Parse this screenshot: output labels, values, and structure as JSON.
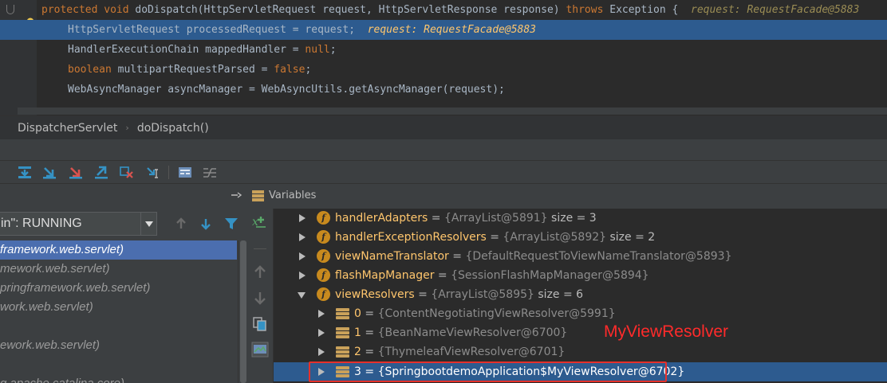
{
  "editor": {
    "lines": [
      {
        "kw1": "protected void ",
        "text": "doDispatch(HttpServletRequest request, HttpServletResponse response) ",
        "kw2": "throws ",
        "rest": "Exception {",
        "inline": "request: RequestFacade@5883"
      },
      {
        "text": "HttpServletRequest processedRequest = request;",
        "inline": "request: RequestFacade@5883"
      },
      {
        "text": "HandlerExecutionChain mappedHandler = ",
        "kw": "null",
        "rest": ";"
      },
      {
        "kw": "boolean ",
        "text": "multipartRequestParsed = ",
        "kw2": "false",
        "rest": ";"
      },
      {
        "text": "WebAsyncManager asyncManager = WebAsyncUtils.getAsyncManager(request);"
      }
    ]
  },
  "breadcrumb": {
    "class_name": "DispatcherServlet",
    "method_name": "doDispatch()",
    "separator": "›"
  },
  "frames": {
    "thread_value": "in\": RUNNING",
    "items": [
      "framework.web.servlet)",
      "mework.web.servlet)",
      "pringframework.web.servlet)",
      "work.web.servlet)",
      "",
      "ework.web.servlet)",
      "",
      "g.apache.catalina.core)"
    ]
  },
  "variables": {
    "title": "Variables",
    "rows": [
      {
        "name": "handlerAdapters",
        "eq": " = ",
        "value": "{ArrayList@5891}",
        "size": "size = 3"
      },
      {
        "name": "handlerExceptionResolvers",
        "eq": " = ",
        "value": "{ArrayList@5892}",
        "size": "size = 2"
      },
      {
        "name": "viewNameTranslator",
        "eq": " = ",
        "value": "{DefaultRequestToViewNameTranslator@5893}",
        "size": ""
      },
      {
        "name": "flashMapManager",
        "eq": " = ",
        "value": "{SessionFlashMapManager@5894}",
        "size": ""
      },
      {
        "name": "viewResolvers",
        "eq": " = ",
        "value": "{ArrayList@5895}",
        "size": "size = 6"
      },
      {
        "name": "0",
        "eq": " = ",
        "value": "{ContentNegotiatingViewResolver@5991}",
        "size": ""
      },
      {
        "name": "1",
        "eq": " = ",
        "value": "{BeanNameViewResolver@6700}",
        "size": ""
      },
      {
        "name": "2",
        "eq": " = ",
        "value": "{ThymeleafViewResolver@6701}",
        "size": ""
      },
      {
        "name": "3",
        "eq": " = ",
        "value": "{SpringbootdemoApplication$MyViewResolver@6702}",
        "size": ""
      }
    ]
  },
  "annotation": {
    "text": "MyViewResolver",
    "color": "#FF2B2B"
  },
  "colors": {
    "selection": "#2D5B8F",
    "frame_selection": "#4B6EAF",
    "field_icon": "#C88A1E",
    "value_name": "#FFC66D"
  }
}
